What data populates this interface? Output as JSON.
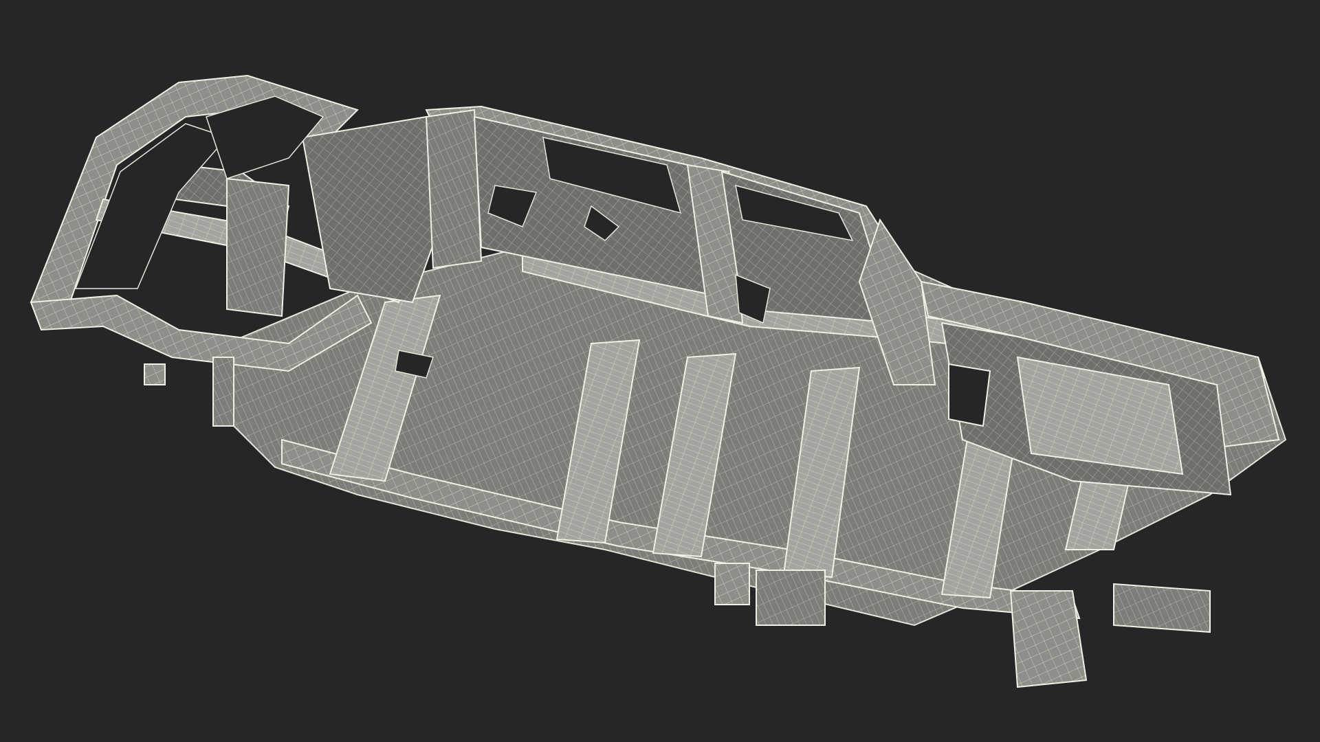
{
  "scene": {
    "subject_icon": "car-body-wireframe-icon",
    "colors": {
      "background": "#262626",
      "panel_fill": "#8e8f89",
      "panel_fill_dark": "#6f706b",
      "panel_fill_light": "#a4a59e",
      "wire": "#e6e6dc",
      "opening": "#262626"
    }
  }
}
